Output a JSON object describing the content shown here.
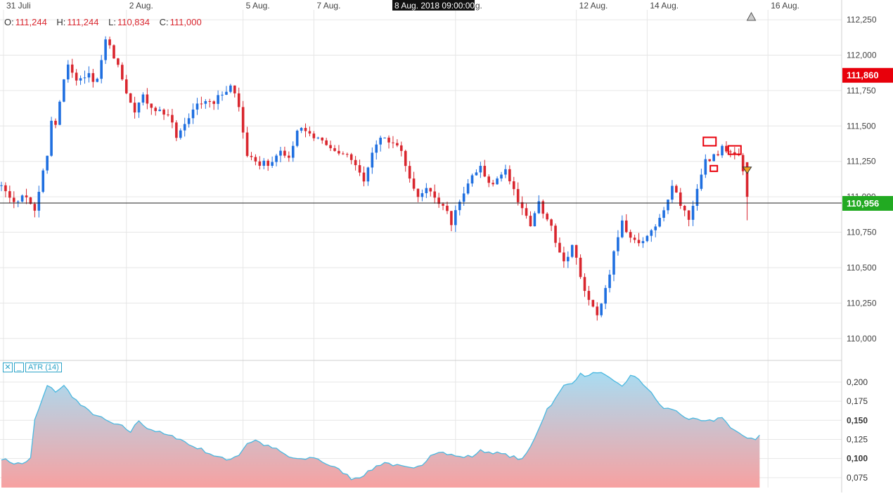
{
  "ohlc": {
    "o_label": "O:",
    "o_value": "111,244",
    "h_label": "H:",
    "h_value": "111,244",
    "l_label": "L:",
    "l_value": "110,834",
    "c_label": "C:",
    "c_value": "111,000"
  },
  "crosshair_label": "8 Aug. 2018 09:00:00",
  "atr_legend": {
    "close_glyph": "✕",
    "min_glyph": "_",
    "label": "ATR (14)"
  },
  "colors": {
    "up": "#1f6fe0",
    "down": "#d9262e",
    "grid": "#e6e6e6",
    "atr_line": "#4ab8e0",
    "atr_fill_top": "#a9dcf2",
    "atr_fill_bottom": "#f7a1a1",
    "badge_red": "#e8000b",
    "badge_green": "#22aa22"
  },
  "chart_data": [
    {
      "type": "candlestick",
      "x_ticks": [
        {
          "label": "31 Juli",
          "pos": 0.5
        },
        {
          "label": "2 Aug.",
          "pos": 30
        },
        {
          "label": "5 Aug.",
          "pos": 58
        },
        {
          "label": "7 Aug.",
          "pos": 75
        },
        {
          "label": "9 Aug.",
          "pos": 109
        },
        {
          "label": "12 Aug.",
          "pos": 138
        },
        {
          "label": "14 Aug.",
          "pos": 155
        },
        {
          "label": "16 Aug.",
          "pos": 184
        }
      ],
      "ylim": [
        109.85,
        112.3
      ],
      "y_ticks": [
        "112,250",
        "112,000",
        "111,750",
        "111,500",
        "111,250",
        "111,000",
        "110,750",
        "110,500",
        "110,250",
        "110,000"
      ],
      "y_tick_values": [
        112.25,
        112.0,
        111.75,
        111.5,
        111.25,
        111.0,
        110.75,
        110.5,
        110.25,
        110.0
      ],
      "price_badges": [
        {
          "label": "111,860",
          "value": 111.86,
          "color": "#e8000b"
        },
        {
          "label": "110,956",
          "value": 110.956,
          "color": "#22aa22"
        }
      ],
      "current_price": 110.956,
      "anchors": [
        [
          0,
          111.08
        ],
        [
          3,
          110.95
        ],
        [
          6,
          111.02
        ],
        [
          8,
          110.9
        ],
        [
          9,
          111.05
        ],
        [
          11,
          111.3
        ],
        [
          12,
          111.55
        ],
        [
          13,
          111.5
        ],
        [
          15,
          111.85
        ],
        [
          16,
          111.92
        ],
        [
          18,
          111.8
        ],
        [
          21,
          111.85
        ],
        [
          23,
          111.82
        ],
        [
          25,
          112.1
        ],
        [
          26,
          112.05
        ],
        [
          28,
          111.95
        ],
        [
          30,
          111.75
        ],
        [
          32,
          111.62
        ],
        [
          34,
          111.7
        ],
        [
          37,
          111.62
        ],
        [
          40,
          111.58
        ],
        [
          42,
          111.42
        ],
        [
          44,
          111.5
        ],
        [
          47,
          111.68
        ],
        [
          50,
          111.65
        ],
        [
          53,
          111.72
        ],
        [
          55,
          111.8
        ],
        [
          57,
          111.65
        ],
        [
          59,
          111.3
        ],
        [
          62,
          111.22
        ],
        [
          65,
          111.25
        ],
        [
          67,
          111.35
        ],
        [
          69,
          111.28
        ],
        [
          71,
          111.48
        ],
        [
          73,
          111.45
        ],
        [
          76,
          111.4
        ],
        [
          78,
          111.35
        ],
        [
          80,
          111.32
        ],
        [
          83,
          111.3
        ],
        [
          85,
          111.22
        ],
        [
          87,
          111.1
        ],
        [
          89,
          111.3
        ],
        [
          91,
          111.4
        ],
        [
          94,
          111.38
        ],
        [
          96,
          111.3
        ],
        [
          98,
          111.15
        ],
        [
          100,
          110.98
        ],
        [
          102,
          111.05
        ],
        [
          104,
          110.98
        ],
        [
          106,
          110.95
        ],
        [
          108,
          110.82
        ],
        [
          110,
          110.95
        ],
        [
          113,
          111.15
        ],
        [
          115,
          111.2
        ],
        [
          117,
          111.08
        ],
        [
          119,
          111.12
        ],
        [
          121,
          111.2
        ],
        [
          123,
          111.05
        ],
        [
          125,
          110.9
        ],
        [
          127,
          110.8
        ],
        [
          129,
          110.95
        ],
        [
          131,
          110.85
        ],
        [
          133,
          110.7
        ],
        [
          135,
          110.55
        ],
        [
          137,
          110.65
        ],
        [
          139,
          110.45
        ],
        [
          141,
          110.25
        ],
        [
          143,
          110.18
        ],
        [
          145,
          110.35
        ],
        [
          147,
          110.6
        ],
        [
          149,
          110.82
        ],
        [
          151,
          110.72
        ],
        [
          153,
          110.65
        ],
        [
          155,
          110.72
        ],
        [
          157,
          110.78
        ],
        [
          159,
          110.9
        ],
        [
          161,
          111.1
        ],
        [
          163,
          110.95
        ],
        [
          165,
          110.85
        ],
        [
          167,
          111.05
        ],
        [
          169,
          111.25
        ],
        [
          171,
          111.28
        ],
        [
          173,
          111.35
        ],
        [
          175,
          111.3
        ],
        [
          177,
          111.28
        ],
        [
          178,
          111.2
        ],
        [
          179,
          111.0
        ]
      ],
      "last_candle": {
        "o": 111.244,
        "h": 111.244,
        "l": 110.834,
        "c": 111.0
      },
      "markers": [
        {
          "type": "square",
          "i": 170,
          "v": 111.39
        },
        {
          "type": "square",
          "i": 176,
          "v": 111.33
        },
        {
          "type": "square-small",
          "i": 171,
          "v": 111.2
        },
        {
          "type": "triangle-down",
          "i": 179,
          "v": 111.19
        },
        {
          "type": "triangle-up",
          "i": 180,
          "v": 112.27
        }
      ]
    },
    {
      "type": "area",
      "series_label": "ATR (14)",
      "ylim": [
        0.062,
        0.222
      ],
      "y_ticks": [
        "0,200",
        "0,175",
        "0,150",
        "0,125",
        "0,100",
        "0,075"
      ],
      "y_tick_values": [
        0.2,
        0.175,
        0.15,
        0.125,
        0.1,
        0.075
      ],
      "y_tick_bold": [
        false,
        false,
        true,
        false,
        true,
        false
      ],
      "anchors": [
        [
          0,
          0.1
        ],
        [
          3,
          0.094
        ],
        [
          5,
          0.093
        ],
        [
          7,
          0.1
        ],
        [
          8,
          0.15
        ],
        [
          10,
          0.18
        ],
        [
          11,
          0.195
        ],
        [
          13,
          0.188
        ],
        [
          15,
          0.195
        ],
        [
          17,
          0.182
        ],
        [
          19,
          0.17
        ],
        [
          21,
          0.162
        ],
        [
          23,
          0.156
        ],
        [
          25,
          0.15
        ],
        [
          27,
          0.145
        ],
        [
          29,
          0.142
        ],
        [
          31,
          0.135
        ],
        [
          33,
          0.15
        ],
        [
          35,
          0.14
        ],
        [
          37,
          0.136
        ],
        [
          40,
          0.13
        ],
        [
          43,
          0.126
        ],
        [
          45,
          0.118
        ],
        [
          48,
          0.112
        ],
        [
          51,
          0.104
        ],
        [
          54,
          0.098
        ],
        [
          57,
          0.105
        ],
        [
          59,
          0.12
        ],
        [
          61,
          0.124
        ],
        [
          63,
          0.118
        ],
        [
          66,
          0.112
        ],
        [
          69,
          0.102
        ],
        [
          72,
          0.098
        ],
        [
          75,
          0.102
        ],
        [
          77,
          0.096
        ],
        [
          80,
          0.088
        ],
        [
          82,
          0.082
        ],
        [
          84,
          0.074
        ],
        [
          86,
          0.076
        ],
        [
          88,
          0.082
        ],
        [
          90,
          0.09
        ],
        [
          92,
          0.095
        ],
        [
          94,
          0.092
        ],
        [
          97,
          0.088
        ],
        [
          99,
          0.086
        ],
        [
          101,
          0.092
        ],
        [
          103,
          0.105
        ],
        [
          105,
          0.11
        ],
        [
          107,
          0.106
        ],
        [
          110,
          0.102
        ],
        [
          113,
          0.103
        ],
        [
          115,
          0.11
        ],
        [
          118,
          0.108
        ],
        [
          120,
          0.106
        ],
        [
          123,
          0.102
        ],
        [
          125,
          0.098
        ],
        [
          127,
          0.115
        ],
        [
          129,
          0.14
        ],
        [
          131,
          0.165
        ],
        [
          133,
          0.178
        ],
        [
          135,
          0.195
        ],
        [
          137,
          0.2
        ],
        [
          139,
          0.21
        ],
        [
          141,
          0.208
        ],
        [
          143,
          0.214
        ],
        [
          145,
          0.208
        ],
        [
          147,
          0.2
        ],
        [
          149,
          0.195
        ],
        [
          151,
          0.208
        ],
        [
          153,
          0.204
        ],
        [
          155,
          0.192
        ],
        [
          157,
          0.178
        ],
        [
          159,
          0.165
        ],
        [
          161,
          0.165
        ],
        [
          163,
          0.158
        ],
        [
          165,
          0.152
        ],
        [
          167,
          0.15
        ],
        [
          169,
          0.148
        ],
        [
          171,
          0.15
        ],
        [
          173,
          0.155
        ],
        [
          175,
          0.14
        ],
        [
          177,
          0.132
        ],
        [
          179,
          0.128
        ],
        [
          181,
          0.126
        ],
        [
          182,
          0.13
        ]
      ]
    }
  ]
}
